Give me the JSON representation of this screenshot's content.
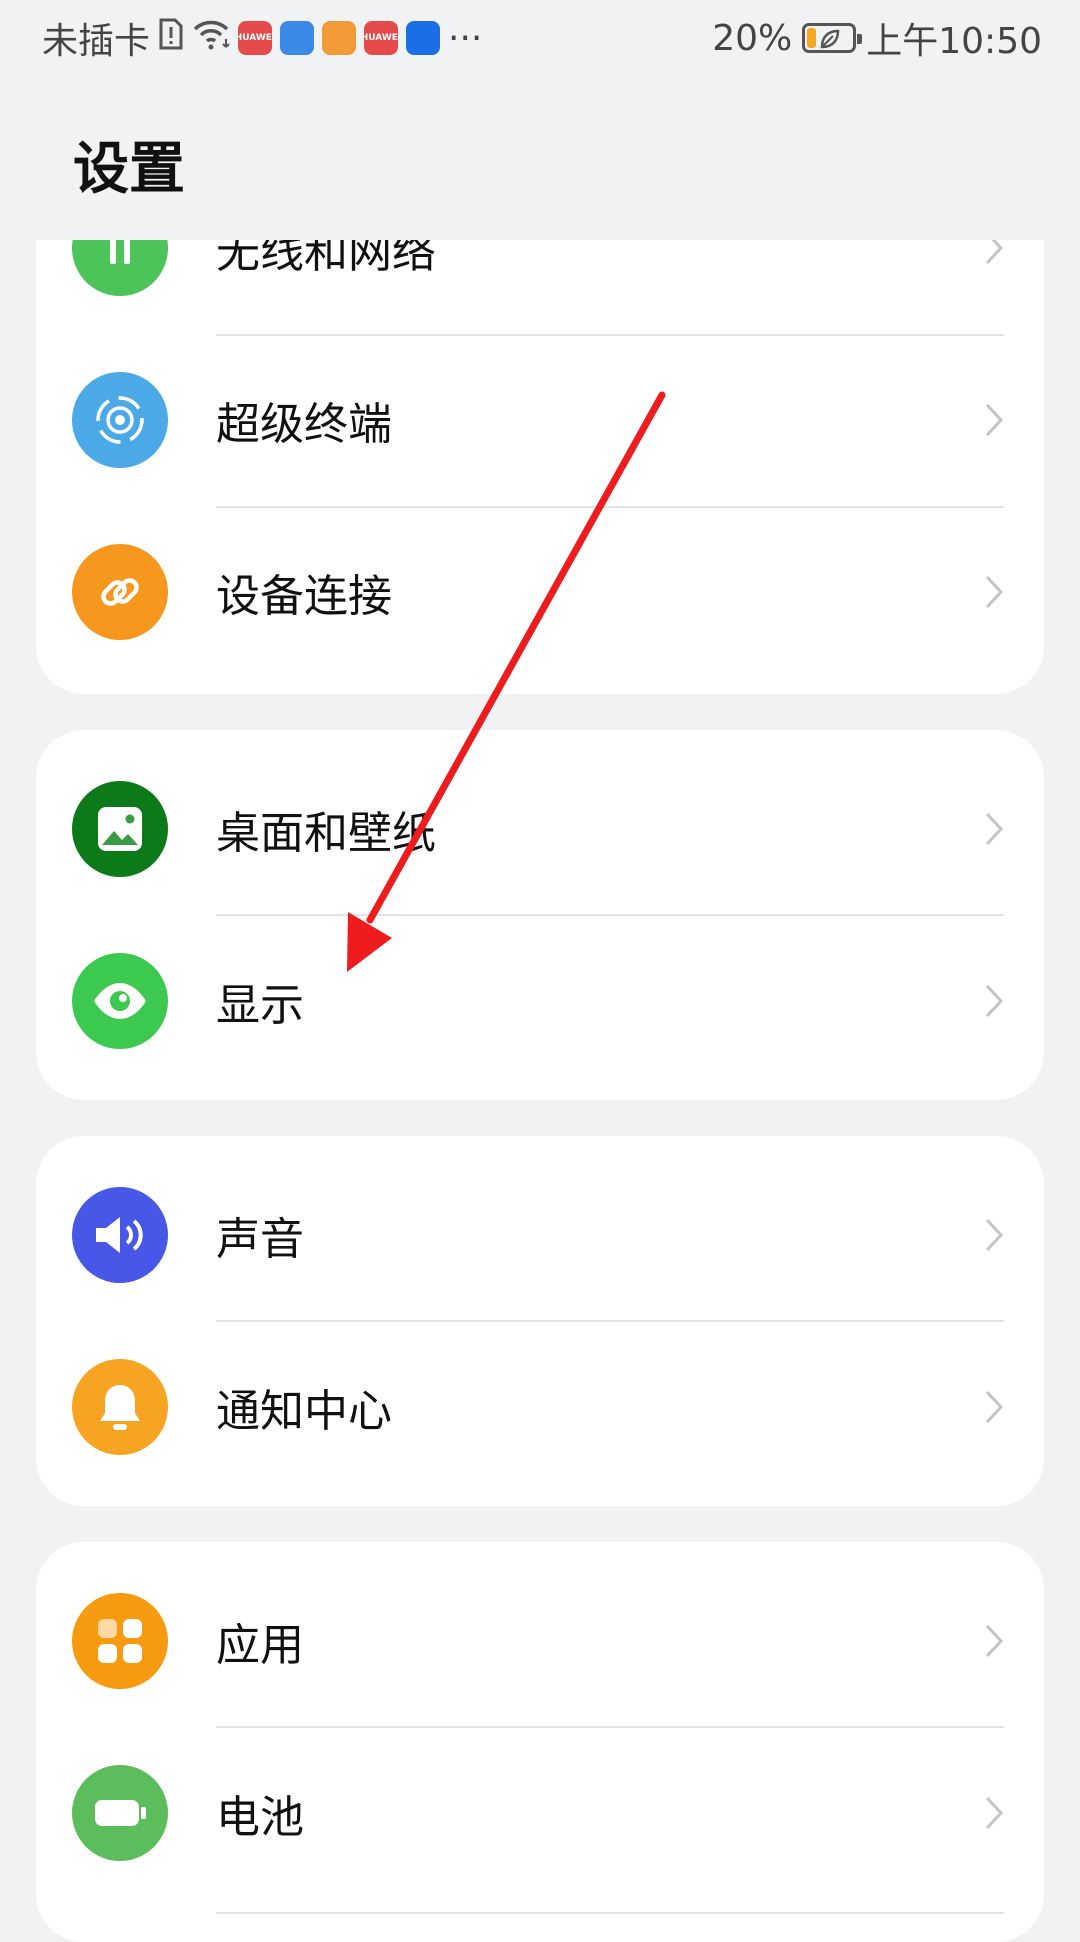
{
  "status_bar": {
    "carrier": "未插卡",
    "apps": [
      {
        "name": "huawei-store",
        "text": "HUAWEI",
        "color": "#e64b4b"
      },
      {
        "name": "browser",
        "text": "",
        "color": "#3b8ae6"
      },
      {
        "name": "video",
        "text": "",
        "color": "#f29a38"
      },
      {
        "name": "huawei-store-2",
        "text": "HUAWEI",
        "color": "#e64b4b"
      },
      {
        "name": "tips",
        "text": "",
        "color": "#1a6ee6"
      }
    ],
    "more": "···",
    "battery_percent_text": "20%",
    "battery_level": 0.2,
    "time": "上午10:50"
  },
  "header": {
    "title": "设置"
  },
  "groups": [
    {
      "items": [
        {
          "label": "无线和网络",
          "icon": "wireless-network-icon",
          "color": "#4cc45a"
        },
        {
          "label": "超级终端",
          "icon": "super-device-icon",
          "color": "#4aa9e6"
        },
        {
          "label": "设备连接",
          "icon": "link-icon",
          "color": "#f7971e"
        }
      ]
    },
    {
      "items": [
        {
          "label": "桌面和壁纸",
          "icon": "wallpaper-icon",
          "color": "#0d7a1a"
        },
        {
          "label": "显示",
          "icon": "eye-icon",
          "color": "#3cc94f"
        }
      ]
    },
    {
      "items": [
        {
          "label": "声音",
          "icon": "speaker-icon",
          "color": "#4757e8"
        },
        {
          "label": "通知中心",
          "icon": "bell-icon",
          "color": "#f7a423"
        }
      ]
    },
    {
      "items": [
        {
          "label": "应用",
          "icon": "apps-icon",
          "color": "#f79a10"
        },
        {
          "label": "电池",
          "icon": "battery-icon",
          "color": "#5bbd5b"
        }
      ]
    }
  ],
  "annotation": {
    "color": "#ee1c1c"
  }
}
